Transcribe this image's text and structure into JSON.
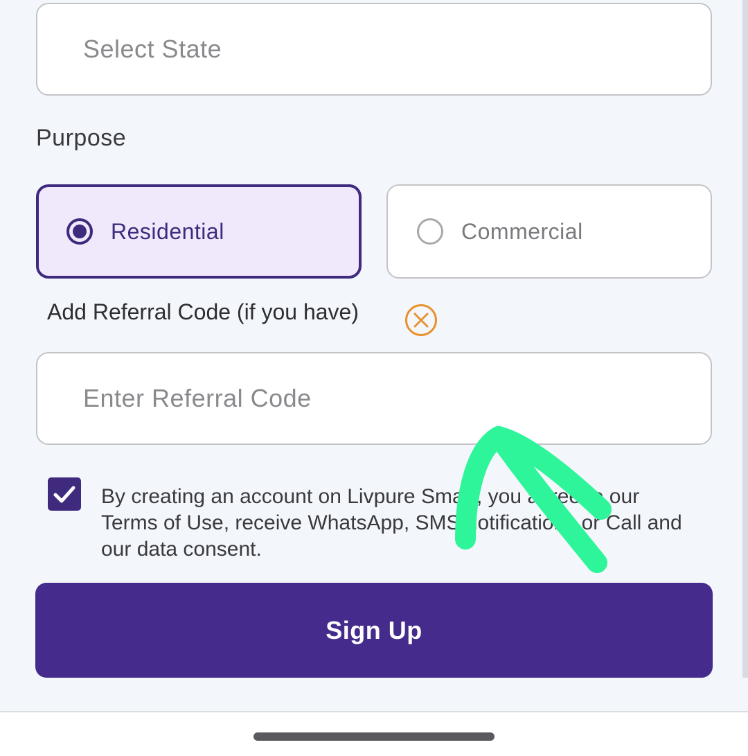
{
  "state_field": {
    "placeholder": "Select State"
  },
  "purpose": {
    "label": "Purpose",
    "options": [
      {
        "label": "Residential",
        "selected": true
      },
      {
        "label": "Commercial",
        "selected": false
      }
    ]
  },
  "referral": {
    "toggle_label": "Add Referral Code (if you have)",
    "placeholder": "Enter Referral Code"
  },
  "consent": {
    "checked": true,
    "text": "By creating an account on Livpure Smart, you agree to our Terms of Use, receive WhatsApp, SMS notifications or Call and our data consent."
  },
  "signup_button": {
    "label": "Sign Up"
  },
  "colors": {
    "primary": "#452b8c",
    "selected_bg": "#efe9fb",
    "close_icon": "#e8922e",
    "annotation": "#2ef59a"
  }
}
